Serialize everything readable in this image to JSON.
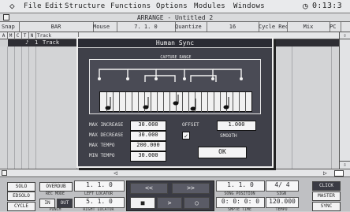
{
  "menubar": {
    "apple_icon": "diamond-icon",
    "items": [
      "File",
      "Edit",
      "Structure",
      "Functions",
      "Options",
      "Modules",
      "Windows"
    ],
    "clock": "0:13:3"
  },
  "window": {
    "title": "ARRANGE - Untitled 2"
  },
  "infobar": {
    "snap_label": "Snap",
    "snap_value": "BAR",
    "mouse_label": "Mouse",
    "mouse_value": "7. 1.   0",
    "quantize_label": "Quantize",
    "quantize_value": "16",
    "cycle_label": "Cycle Rec",
    "cycle_value": "Mix",
    "pc": "PC"
  },
  "columns": {
    "a": "A",
    "m": "M",
    "c": "C",
    "t": "T",
    "n": "N",
    "track": "Track"
  },
  "track": {
    "arrow": "♪",
    "number": "1",
    "name": "Track"
  },
  "dialog": {
    "title": "Human Sync",
    "capture_range_label": "CAPTURE RANGE",
    "params": [
      {
        "label": "MAX INCREASE",
        "value": "30.000"
      },
      {
        "label": "MAX DECREASE",
        "value": "30.000"
      },
      {
        "label": "MAX TEMPO",
        "value": "200.000"
      },
      {
        "label": "MIN TEMPO",
        "value": "30.000"
      }
    ],
    "offset_label": "OFFSET",
    "offset_value": "1.000",
    "smooth_label": "SMOOTH",
    "ok_label": "OK"
  },
  "transport": {
    "solo": "SOLO",
    "overdub": "OVERDUB",
    "edsolo": "EDSOLO",
    "rec_mode": "REC MODE",
    "cycle": "CYCLE",
    "in": "IN",
    "out": "OUT",
    "punch": "PUNCH",
    "left_locator_value": "1.  1.   0",
    "left_locator_label": "LEFT LOCATOR",
    "right_locator_value": "5.  1.   0",
    "right_locator_label": "RIGHT LOCATOR",
    "rewind": "<<",
    "ffwd": ">>",
    "stop": "■",
    "play": ">",
    "record": "○",
    "song_position_value": "1.  1.   0",
    "song_position_label": "SONG POSITION",
    "smpte_value": "0: 0: 0: 0",
    "smpte_label": "SMPTE TIME",
    "signature_value": "4/ 4",
    "signature_label": "SIGN",
    "tempo_value": "120.000",
    "tempo_label": "TEMPO",
    "click": "CLICK",
    "master": "MASTER",
    "sync": "SYNC"
  },
  "colors": {
    "dialog_bg": "#3f4049",
    "bar_bg": "#e9eaec",
    "track_bg": "#2e2e34"
  }
}
